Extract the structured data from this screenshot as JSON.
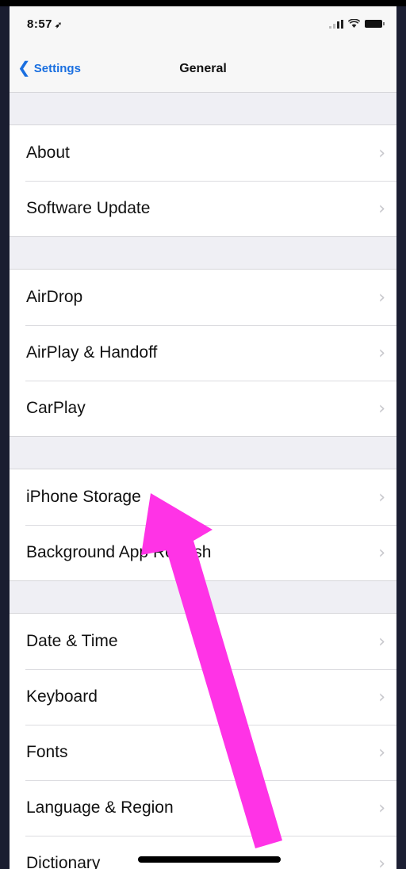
{
  "status_bar": {
    "time": "8:57",
    "location_arrow": "➶"
  },
  "nav": {
    "back_label": "Settings",
    "title": "General"
  },
  "groups": [
    {
      "items": [
        "About",
        "Software Update"
      ]
    },
    {
      "items": [
        "AirDrop",
        "AirPlay & Handoff",
        "CarPlay"
      ]
    },
    {
      "items": [
        "iPhone Storage",
        "Background App Refresh"
      ]
    },
    {
      "items": [
        "Date & Time",
        "Keyboard",
        "Fonts",
        "Language & Region",
        "Dictionary"
      ]
    }
  ],
  "annotation": {
    "arrow_color": "#ff33e6",
    "points_to": "iPhone Storage"
  },
  "colors": {
    "accent": "#1a6fe0",
    "chevron": "#c7c7cc"
  }
}
